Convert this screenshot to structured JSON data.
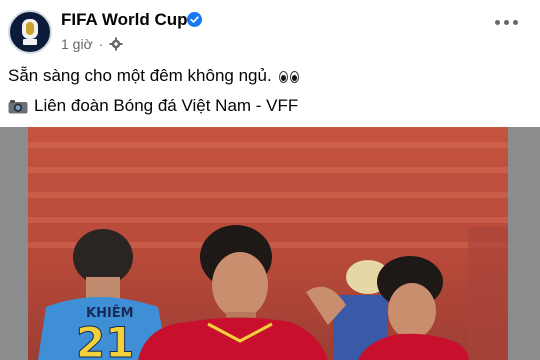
{
  "post": {
    "author": "FIFA World Cup",
    "verified": true,
    "timestamp": "1 giờ",
    "privacy_icon": "gear-icon",
    "caption_line1": "Sẵn sàng cho một đêm không ngủ.",
    "caption_line2": "Liên đoàn Bóng đá Việt Nam - VFF",
    "more_icon": "more-options-icon"
  },
  "photo": {
    "jersey_name": "KHIÊM",
    "jersey_number": "21"
  },
  "colors": {
    "text": "#050505",
    "secondary": "#65676b",
    "verified": "#1877f2",
    "vietnam_red": "#c8102e"
  }
}
